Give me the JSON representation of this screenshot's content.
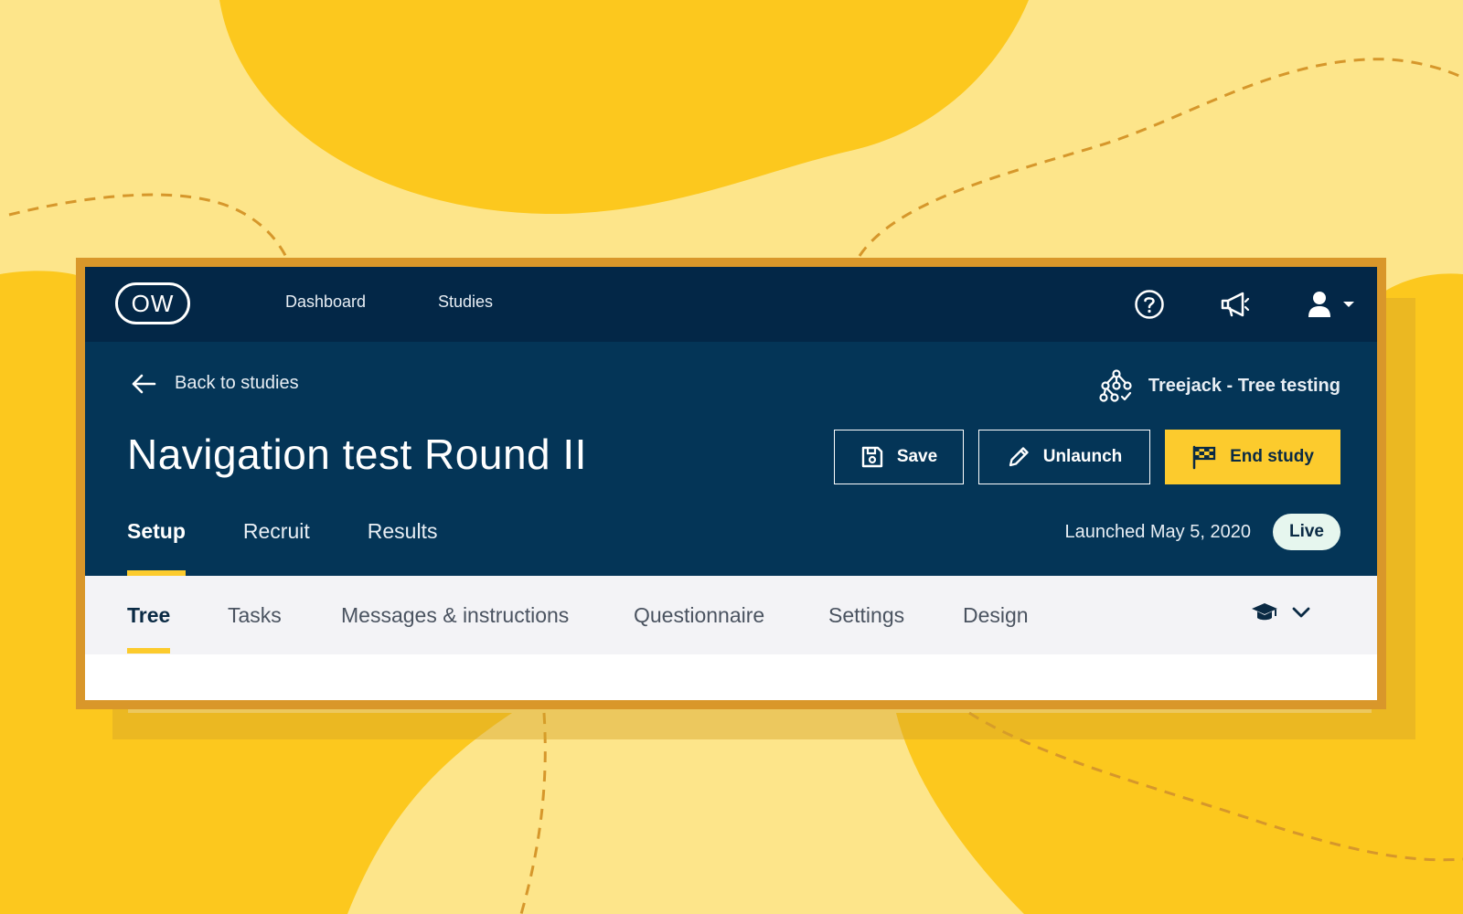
{
  "nav": {
    "logo_text": "OW",
    "links": [
      "Dashboard",
      "Studies"
    ],
    "icons": [
      "help-icon",
      "megaphone-icon",
      "user-icon",
      "caret-down-icon"
    ]
  },
  "header": {
    "back_label": "Back to studies",
    "study_type": "Treejack - Tree testing",
    "title": "Navigation test Round II",
    "buttons": {
      "save": "Save",
      "unlaunch": "Unlaunch",
      "end_study": "End study"
    },
    "tabs": [
      {
        "label": "Setup",
        "active": true
      },
      {
        "label": "Recruit",
        "active": false
      },
      {
        "label": "Results",
        "active": false
      }
    ],
    "launched_text": "Launched May 5, 2020",
    "status_badge": "Live"
  },
  "subtabs": [
    {
      "label": "Tree",
      "active": true
    },
    {
      "label": "Tasks",
      "active": false
    },
    {
      "label": "Messages & instructions",
      "active": false
    },
    {
      "label": "Questionnaire",
      "active": false
    },
    {
      "label": "Settings",
      "active": false
    },
    {
      "label": "Design",
      "active": false
    }
  ],
  "colors": {
    "nav_bg": "#032747",
    "header_bg": "#043557",
    "accent": "#fccb2d",
    "background": "#fde58a",
    "frame": "#d9972a"
  }
}
